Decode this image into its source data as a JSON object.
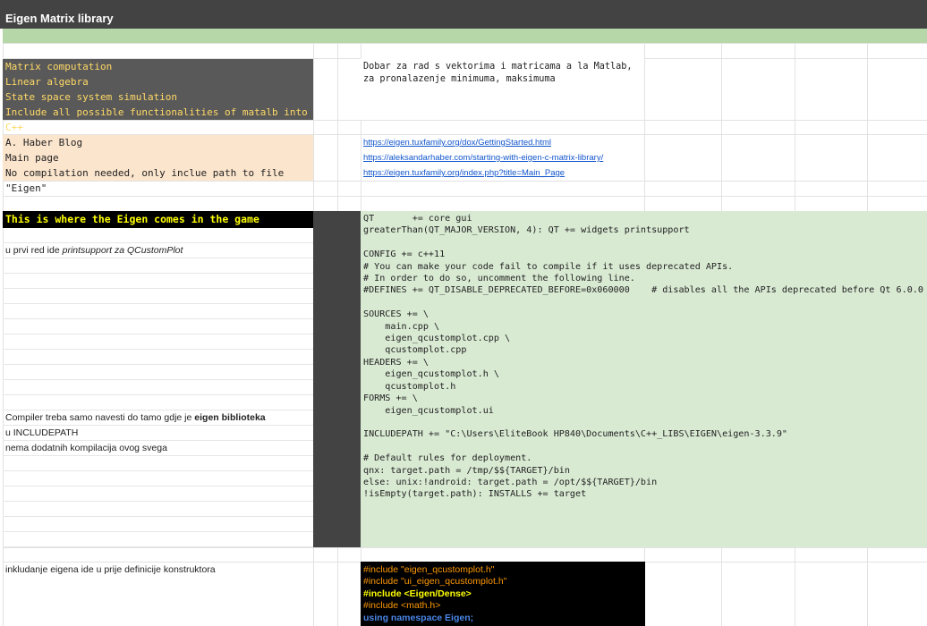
{
  "sheet": {
    "title": "Eigen Matrix library",
    "colors": {
      "header_bg": "#434343",
      "green_band": "#b6d7a8",
      "dark_cell": "#595959",
      "dark_cell_text": "#ffd966",
      "peach_cell": "#fce5cd",
      "link": "#1155cc",
      "code_bg": "#d9ead3"
    },
    "features": [
      "Matrix computation",
      "Linear algebra",
      "State space system simulation",
      "Include all possible functionalities of matalb into C++"
    ],
    "description": [
      "Dobar za rad s vektorima i matricama a la Matlab,",
      "za pronalazenje minimuma, maksimuma"
    ],
    "resources": [
      {
        "label": "A. Haber Blog",
        "url": "https://eigen.tuxfamily.org/dox/GettingStarted.html"
      },
      {
        "label": "Main page",
        "url": "https://aleksandarhaber.com/starting-with-eigen-c-matrix-library/"
      },
      {
        "label": "No compilation needed, only inclue path to file \"Eigen\"",
        "url": "https://eigen.tuxfamily.org/index.php?title=Main_Page"
      }
    ],
    "section_header": "This is where the Eigen comes in the game",
    "notes": {
      "printsupport_prefix": "u prvi red ide ",
      "printsupport_emph": "printsupport za QCustomPlot",
      "compiler_prefix": "Compiler treba samo navesti do tamo gdje je ",
      "compiler_bold": "eigen biblioteka",
      "includepath": "u INCLUDEPATH",
      "no_compile": "nema dodatnih kompilacija ovog svega",
      "include_note": "inkludanje eigena ide u prije definicije konstruktora"
    },
    "pro_file": "QT       += core gui\ngreaterThan(QT_MAJOR_VERSION, 4): QT += widgets printsupport\n\nCONFIG += c++11\n# You can make your code fail to compile if it uses deprecated APIs.\n# In order to do so, uncomment the following line.\n#DEFINES += QT_DISABLE_DEPRECATED_BEFORE=0x060000    # disables all the APIs deprecated before Qt 6.0.0\n\nSOURCES += \\\n    main.cpp \\\n    eigen_qcustomplot.cpp \\\n    qcustomplot.cpp\nHEADERS += \\\n    eigen_qcustomplot.h \\\n    qcustomplot.h\nFORMS += \\\n    eigen_qcustomplot.ui\n\nINCLUDEPATH += \"C:\\Users\\EliteBook HP840\\Documents\\C++_LIBS\\EIGEN\\eigen-3.3.9\"\n\n# Default rules for deployment.\nqnx: target.path = /tmp/$${TARGET}/bin\nelse: unix:!android: target.path = /opt/$${TARGET}/bin\n!isEmpty(target.path): INSTALLS += target",
    "includes": [
      {
        "text": "#include \"eigen_qcustomplot.h\"",
        "color": "#ff9900",
        "bold": false
      },
      {
        "text": "#include \"ui_eigen_qcustomplot.h\"",
        "color": "#ff9900",
        "bold": false
      },
      {
        "text": "#include <Eigen/Dense>",
        "color": "#ffff00",
        "bold": true
      },
      {
        "text": "#include <math.h>",
        "color": "#ff9900",
        "bold": false
      },
      {
        "text": "using namespace Eigen;",
        "color": "#4a86e8",
        "bold": true
      }
    ]
  }
}
